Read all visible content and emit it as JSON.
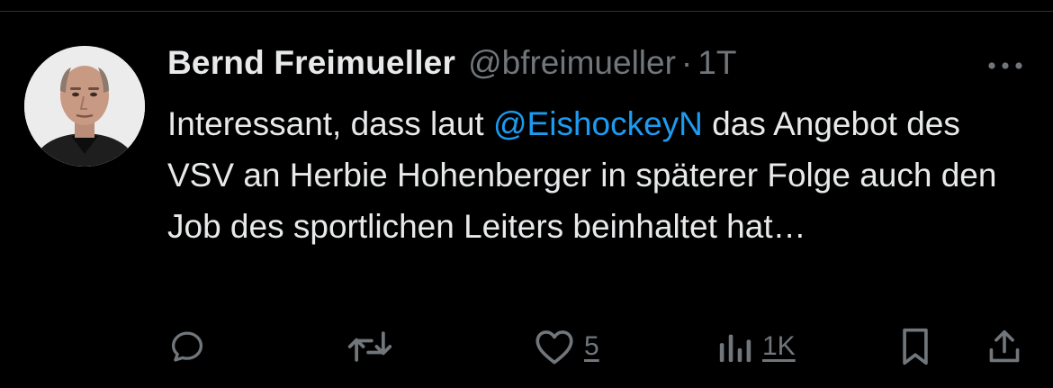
{
  "tweet": {
    "author_name": "Bernd Freimueller",
    "author_handle": "@bfreimueller",
    "separator": "·",
    "timestamp": "1T",
    "text_intro": "Interessant, dass laut ",
    "mention": "@EishockeyN",
    "text_rest": " das Angebot des VSV an Herbie Hohenberger in späterer Folge auch den Job des sportlichen Leiters beinhaltet hat…"
  },
  "actions": {
    "reply_icon": "reply-icon",
    "retweet_icon": "retweet-icon",
    "like_icon": "heart-icon",
    "like_count": "5",
    "views_icon": "views-chart-icon",
    "views_count": "1K",
    "bookmark_icon": "bookmark-icon",
    "share_icon": "share-icon"
  },
  "colors": {
    "background": "#000000",
    "text_primary": "#e7e9ea",
    "text_secondary": "#71767b",
    "accent_link": "#1d9bf0",
    "divider": "#2f3336"
  }
}
